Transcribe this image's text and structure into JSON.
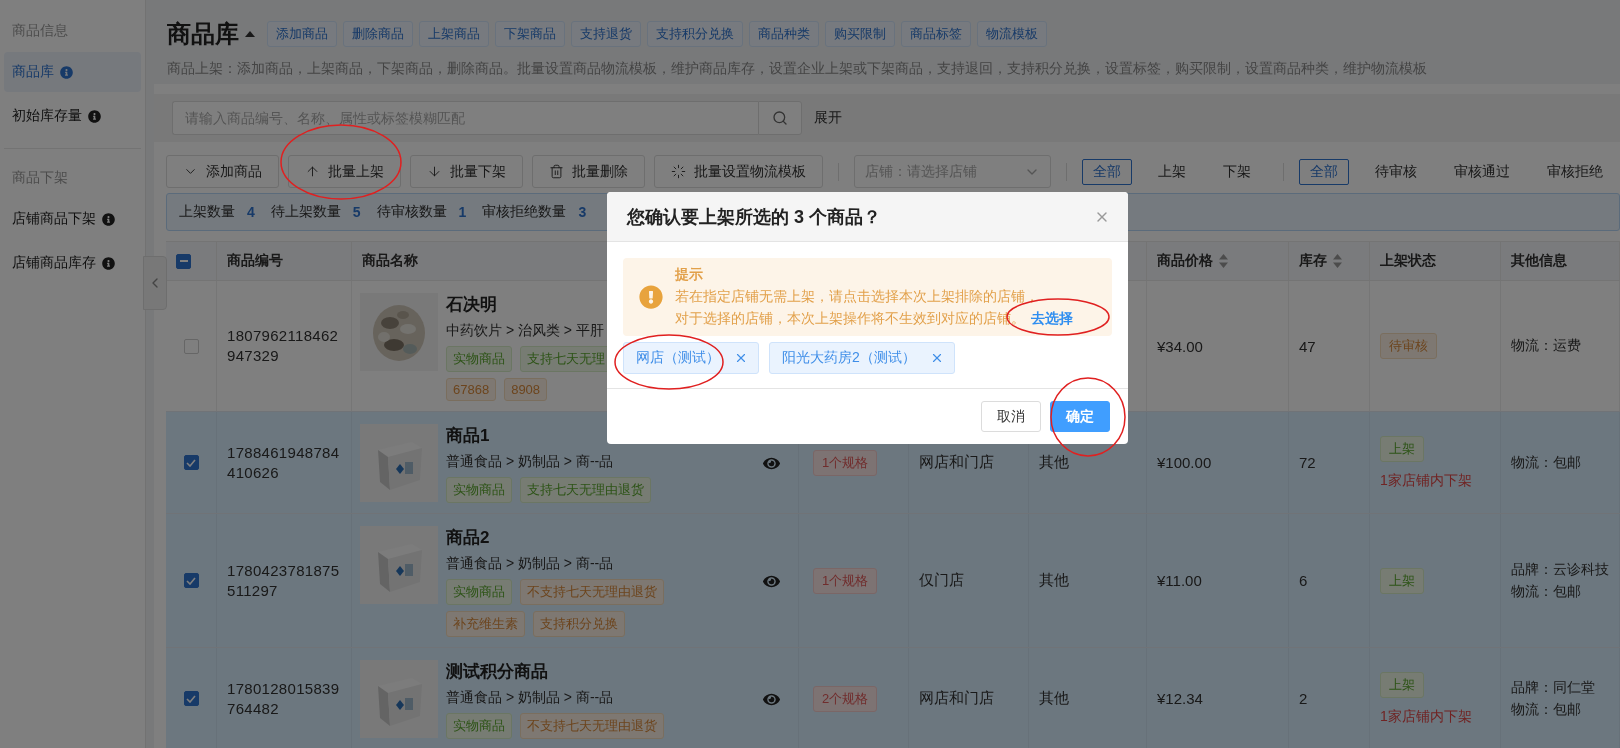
{
  "sidebar": {
    "sections": [
      {
        "title": "商品信息",
        "items": [
          {
            "label": "商品库",
            "selected": true
          },
          {
            "label": "初始库存量",
            "selected": false
          }
        ]
      },
      {
        "title": "商品下架",
        "items": [
          {
            "label": "店铺商品下架",
            "selected": false
          },
          {
            "label": "店铺商品库存",
            "selected": false
          }
        ]
      }
    ]
  },
  "header": {
    "title": "商品库",
    "tags": [
      "添加商品",
      "删除商品",
      "上架商品",
      "下架商品",
      "支持退货",
      "支持积分兑换",
      "商品种类",
      "购买限制",
      "商品标签",
      "物流模板"
    ],
    "description": "商品上架：添加商品，上架商品，下架商品，删除商品。批量设置商品物流模板，维护商品库存，设置企业上架或下架商品，支持退回，支持积分兑换，设置标签，购买限制，设置商品种类，维护物流模板"
  },
  "search": {
    "placeholder": "请输入商品编号、名称、属性或标签模糊匹配",
    "expand": "展开"
  },
  "toolbar": {
    "buttons": [
      "添加商品",
      "批量上架",
      "批量下架",
      "批量删除",
      "批量设置物流模板"
    ],
    "store_select": {
      "placeholder": "店铺：请选择店铺"
    },
    "filters": [
      [
        {
          "label": "全部",
          "selected": true
        },
        {
          "label": "上架",
          "selected": false
        },
        {
          "label": "下架",
          "selected": false
        }
      ],
      [
        {
          "label": "全部",
          "selected": true
        },
        {
          "label": "待审核",
          "selected": false
        },
        {
          "label": "审核通过",
          "selected": false
        },
        {
          "label": "审核拒绝",
          "selected": false
        }
      ]
    ]
  },
  "stats": [
    {
      "label": "上架数量",
      "value": "4"
    },
    {
      "label": "待上架数量",
      "value": "5"
    },
    {
      "label": "待审核数量",
      "value": "1"
    },
    {
      "label": "审核拒绝数量",
      "value": "3"
    }
  ],
  "table": {
    "select_all": {
      "indeterminate": true
    },
    "columns": {
      "id": "商品编号",
      "name": "商品名称",
      "price": {
        "label": "商品价格",
        "sortable": true
      },
      "stock": {
        "label": "库存",
        "sortable": true
      },
      "status": "上架状态",
      "info": "其他信息"
    },
    "rows": [
      {
        "selected": false,
        "id": "1807962118462947329",
        "name": "石决明",
        "category": "中药饮片 > 治风类 > 平肝",
        "tag_lines": [
          [
            {
              "label": "实物商品",
              "kind": "success"
            },
            {
              "label": "支持七天无理",
              "kind": "success"
            }
          ],
          [
            {
              "label": "67868",
              "kind": "warning"
            },
            {
              "label": "8908",
              "kind": "warning"
            }
          ]
        ],
        "price": "¥34.00",
        "stock": "47",
        "status": {
          "label": "待审核",
          "kind": "pending"
        },
        "info": [
          "物流：运费"
        ]
      },
      {
        "selected": true,
        "id": "1788461948784410626",
        "name": "商品1",
        "category": "普通食品 > 奶制品 > 商--品",
        "tag_lines": [
          [
            {
              "label": "实物商品",
              "kind": "success"
            },
            {
              "label": "支持七天无理由退货",
              "kind": "success"
            }
          ]
        ],
        "spec": "1个规格",
        "store": "网店和门店",
        "type": "其他",
        "price": "¥100.00",
        "stock": "72",
        "status": {
          "label": "上架",
          "kind": "listed"
        },
        "note": "1家店铺内下架",
        "info": [
          "物流：包邮"
        ]
      },
      {
        "selected": true,
        "id": "1780423781875511297",
        "name": "商品2",
        "category": "普通食品 > 奶制品 > 商--品",
        "tag_lines": [
          [
            {
              "label": "实物商品",
              "kind": "success"
            },
            {
              "label": "不支持七天无理由退货",
              "kind": "warning"
            }
          ],
          [
            {
              "label": "补充维生素",
              "kind": "warning"
            },
            {
              "label": "支持积分兑换",
              "kind": "warning"
            }
          ]
        ],
        "spec": "1个规格",
        "store": "仅门店",
        "type": "其他",
        "price": "¥11.00",
        "stock": "6",
        "status": {
          "label": "上架",
          "kind": "listed"
        },
        "info": [
          "品牌：云诊科技",
          "物流：包邮"
        ]
      },
      {
        "selected": true,
        "id": "1780128015839764482",
        "name": "测试积分商品",
        "category": "普通食品 > 奶制品 > 商--品",
        "tag_lines": [
          [
            {
              "label": "实物商品",
              "kind": "success"
            },
            {
              "label": "不支持七天无理由退货",
              "kind": "warning"
            }
          ]
        ],
        "spec": "2个规格",
        "store": "网店和门店",
        "type": "其他",
        "price": "¥12.34",
        "stock": "2",
        "status": {
          "label": "上架",
          "kind": "listed"
        },
        "note": "1家店铺内下架",
        "info": [
          "品牌：同仁堂",
          "物流：包邮"
        ]
      }
    ]
  },
  "modal": {
    "title": "您确认要上架所选的 3 个商品？",
    "alert": {
      "title": "提示",
      "lines": [
        "若在指定店铺无需上架，请点击选择本次上架排除的店铺，",
        "对于选择的店铺，本次上架操作将不生效到对应的店铺。"
      ],
      "link": "去选择"
    },
    "stores": [
      "网店（测试）",
      "阳光大药房2（测试）"
    ],
    "buttons": {
      "cancel": "取消",
      "confirm": "确定"
    }
  }
}
